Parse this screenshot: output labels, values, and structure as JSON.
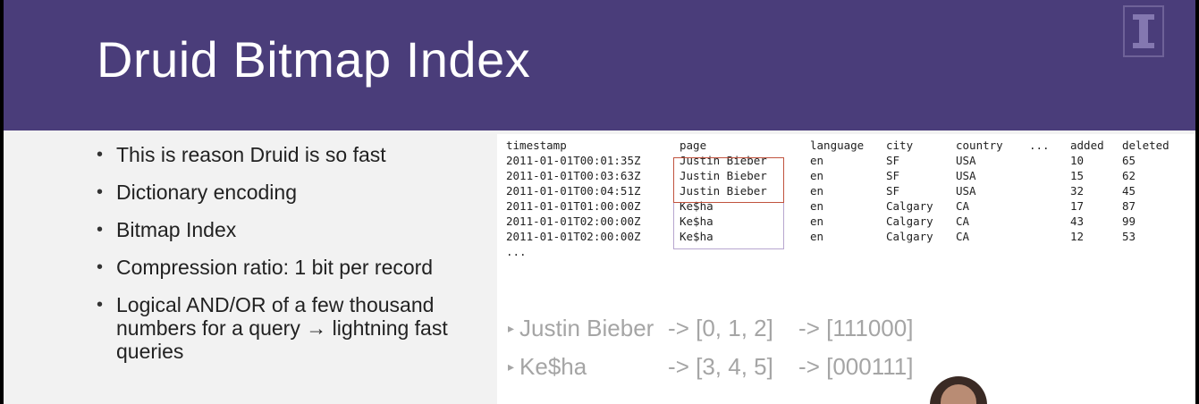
{
  "slide": {
    "title": "Druid Bitmap Index",
    "logo_letter": "I",
    "colors": {
      "header": "#4a3d7a",
      "body": "#f2f2f2",
      "bieber_box": "#c0533e",
      "kesha_box": "#b7a6cf"
    }
  },
  "bullets": [
    "This is reason Druid is so fast",
    "Dictionary encoding",
    "Bitmap Index",
    "Compression ratio: 1 bit per record",
    "Logical AND/OR of a few thousand numbers for a query → lightning fast queries"
  ],
  "bullet_symbol": "•",
  "table": {
    "headers": [
      "timestamp",
      "page",
      "language",
      "city",
      "country",
      "...",
      "added",
      "deleted"
    ],
    "rows": [
      [
        "2011-01-01T00:01:35Z",
        "Justin Bieber",
        "en",
        "SF",
        "USA",
        "",
        "10",
        "65"
      ],
      [
        "2011-01-01T00:03:63Z",
        "Justin Bieber",
        "en",
        "SF",
        "USA",
        "",
        "15",
        "62"
      ],
      [
        "2011-01-01T00:04:51Z",
        "Justin Bieber",
        "en",
        "SF",
        "USA",
        "",
        "32",
        "45"
      ],
      [
        "2011-01-01T01:00:00Z",
        "Ke$ha",
        "en",
        "Calgary",
        "CA",
        "",
        "17",
        "87"
      ],
      [
        "2011-01-01T02:00:00Z",
        "Ke$ha",
        "en",
        "Calgary",
        "CA",
        "",
        "43",
        "99"
      ],
      [
        "2011-01-01T02:00:00Z",
        "Ke$ha",
        "en",
        "Calgary",
        "CA",
        "",
        "12",
        "53"
      ]
    ],
    "ellipsis": "..."
  },
  "mappings": [
    {
      "marker": "▸",
      "name": "Justin Bieber",
      "ids": "-> [0, 1, 2]",
      "bitmap": "-> [111000]"
    },
    {
      "marker": "▸",
      "name": "Ke$ha",
      "ids": "-> [3, 4, 5]",
      "bitmap": "-> [000111]"
    }
  ]
}
